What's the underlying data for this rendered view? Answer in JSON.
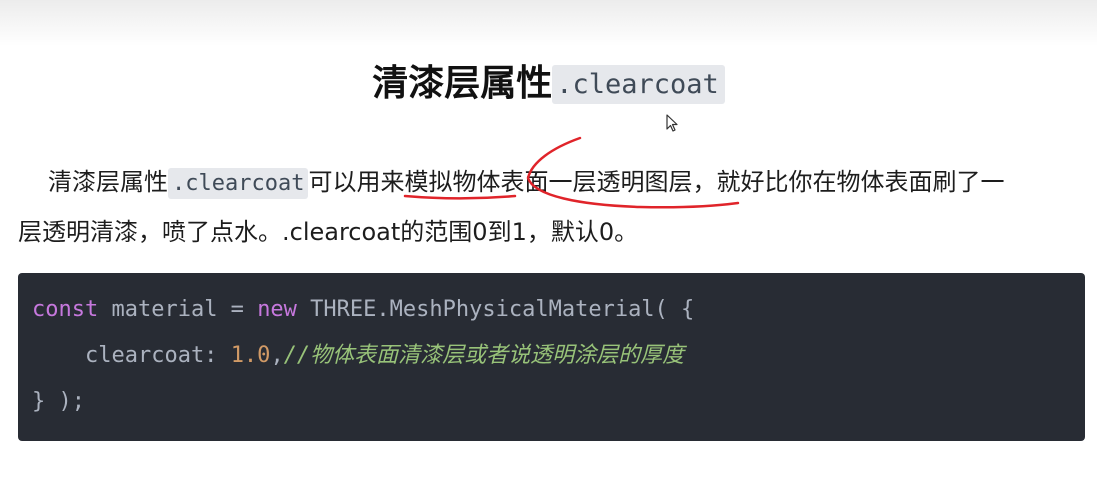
{
  "heading": {
    "text": "清漆层属性",
    "code": ".clearcoat"
  },
  "paragraph": {
    "line1_before": "清漆层属性",
    "line1_code": ".clearcoat",
    "line1_after": "可以用来模拟物体表面一层透明图层，就好比你在物体表面刷了一",
    "line2": "层透明清漆，喷了点水。.clearcoat的范围0到1，默认0。"
  },
  "code": {
    "line1_kw1": "const",
    "line1_mid": " material = ",
    "line1_kw2": "new",
    "line1_rest": " THREE.MeshPhysicalMaterial( {",
    "line2_key": "    clearcoat: ",
    "line2_num": "1.0",
    "line2_comma": ",",
    "line2_comment": "//物体表面清漆层或者说透明涂层的厚度",
    "line3": "} );"
  },
  "colors": {
    "code_bg": "#282c34",
    "keyword": "#c678dd",
    "number": "#d19a66",
    "comment": "#98c379",
    "annotation": "#e0242a"
  },
  "icons": {
    "cursor": "mouse-pointer-icon"
  }
}
